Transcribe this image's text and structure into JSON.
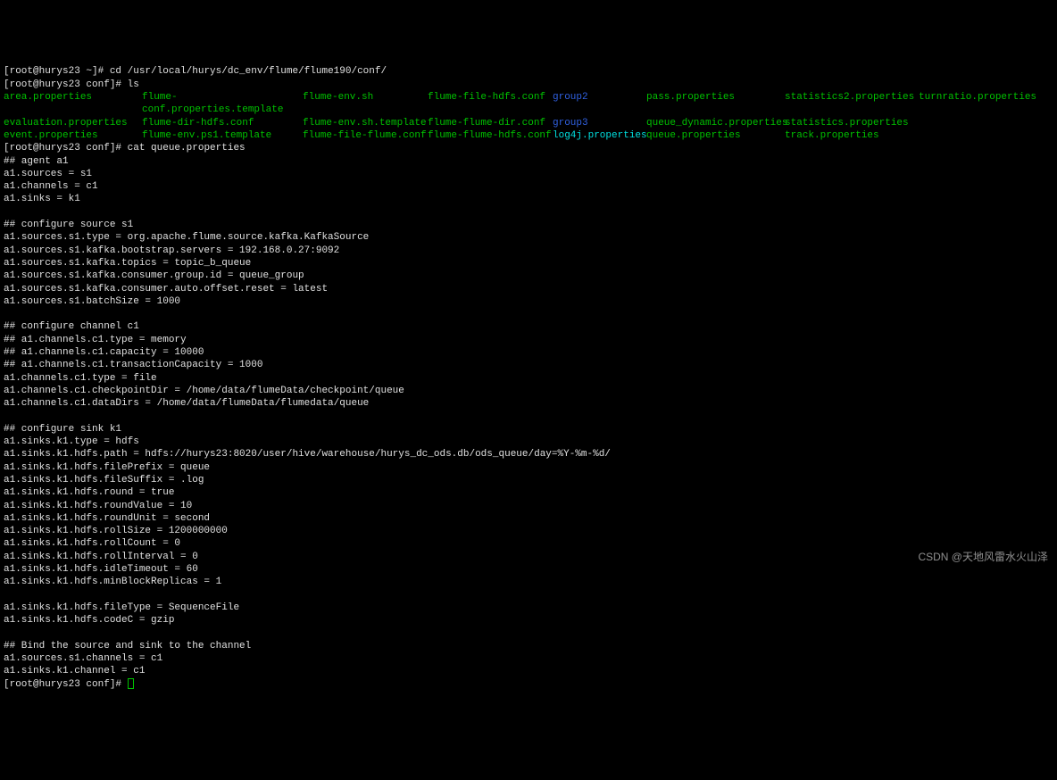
{
  "term": {
    "line1_prompt": "[root@hurys23 ~]# ",
    "line1_cmd": "cd /usr/local/hurys/dc_env/flume/flume190/conf/",
    "line2_prompt": "[root@hurys23 conf]# ",
    "line2_cmd": "ls",
    "line3_prompt": "[root@hurys23 conf]# ",
    "line3_cmd": "cat queue.properties",
    "line_last_prompt": "[root@hurys23 conf]# "
  },
  "ls": {
    "c0r0": "area.properties",
    "c0r1": "evaluation.properties",
    "c0r2": "event.properties",
    "c1r0": "flume-conf.properties.template",
    "c1r1": "flume-dir-hdfs.conf",
    "c1r2": "flume-env.ps1.template",
    "c2r0": "flume-env.sh",
    "c2r1": "flume-env.sh.template",
    "c2r2": "flume-file-flume.conf",
    "c3r0": "flume-file-hdfs.conf",
    "c3r1": "flume-flume-dir.conf",
    "c3r2": "flume-flume-hdfs.conf",
    "c4r0": "group2",
    "c4r1": "group3",
    "c4r2": "log4j.properties",
    "c5r0": "pass.properties",
    "c5r1": "queue_dynamic.properties",
    "c5r2": "queue.properties",
    "c6r0": "statistics2.properties",
    "c6r1": "statistics.properties",
    "c6r2": "track.properties",
    "c7r0": "turnratio.properties"
  },
  "cat": {
    "l00": "## agent a1",
    "l01": "a1.sources = s1",
    "l02": "a1.channels = c1",
    "l03": "a1.sinks = k1",
    "l04": "",
    "l05": "## configure source s1",
    "l06": "a1.sources.s1.type = org.apache.flume.source.kafka.KafkaSource",
    "l07": "a1.sources.s1.kafka.bootstrap.servers = 192.168.0.27:9092",
    "l08": "a1.sources.s1.kafka.topics = topic_b_queue",
    "l09": "a1.sources.s1.kafka.consumer.group.id = queue_group",
    "l10": "a1.sources.s1.kafka.consumer.auto.offset.reset = latest",
    "l11": "a1.sources.s1.batchSize = 1000",
    "l12": "",
    "l13": "## configure channel c1",
    "l14": "## a1.channels.c1.type = memory",
    "l15": "## a1.channels.c1.capacity = 10000",
    "l16": "## a1.channels.c1.transactionCapacity = 1000",
    "l17": "a1.channels.c1.type = file",
    "l18": "a1.channels.c1.checkpointDir = /home/data/flumeData/checkpoint/queue",
    "l19": "a1.channels.c1.dataDirs = /home/data/flumeData/flumedata/queue",
    "l20": "",
    "l21": "## configure sink k1",
    "l22": "a1.sinks.k1.type = hdfs",
    "l23": "a1.sinks.k1.hdfs.path = hdfs://hurys23:8020/user/hive/warehouse/hurys_dc_ods.db/ods_queue/day=%Y-%m-%d/",
    "l24": "a1.sinks.k1.hdfs.filePrefix = queue",
    "l25": "a1.sinks.k1.hdfs.fileSuffix = .log",
    "l26": "a1.sinks.k1.hdfs.round = true",
    "l27": "a1.sinks.k1.hdfs.roundValue = 10",
    "l28": "a1.sinks.k1.hdfs.roundUnit = second",
    "l29": "a1.sinks.k1.hdfs.rollSize = 1200000000",
    "l30": "a1.sinks.k1.hdfs.rollCount = 0",
    "l31": "a1.sinks.k1.hdfs.rollInterval = 0",
    "l32": "a1.sinks.k1.hdfs.idleTimeout = 60",
    "l33": "a1.sinks.k1.hdfs.minBlockReplicas = 1",
    "l34": "",
    "l35": "a1.sinks.k1.hdfs.fileType = SequenceFile",
    "l36": "a1.sinks.k1.hdfs.codeC = gzip",
    "l37": "",
    "l38": "## Bind the source and sink to the channel",
    "l39": "a1.sources.s1.channels = c1",
    "l40": "a1.sinks.k1.channel = c1"
  },
  "watermark": "CSDN @天地风雷水火山泽"
}
